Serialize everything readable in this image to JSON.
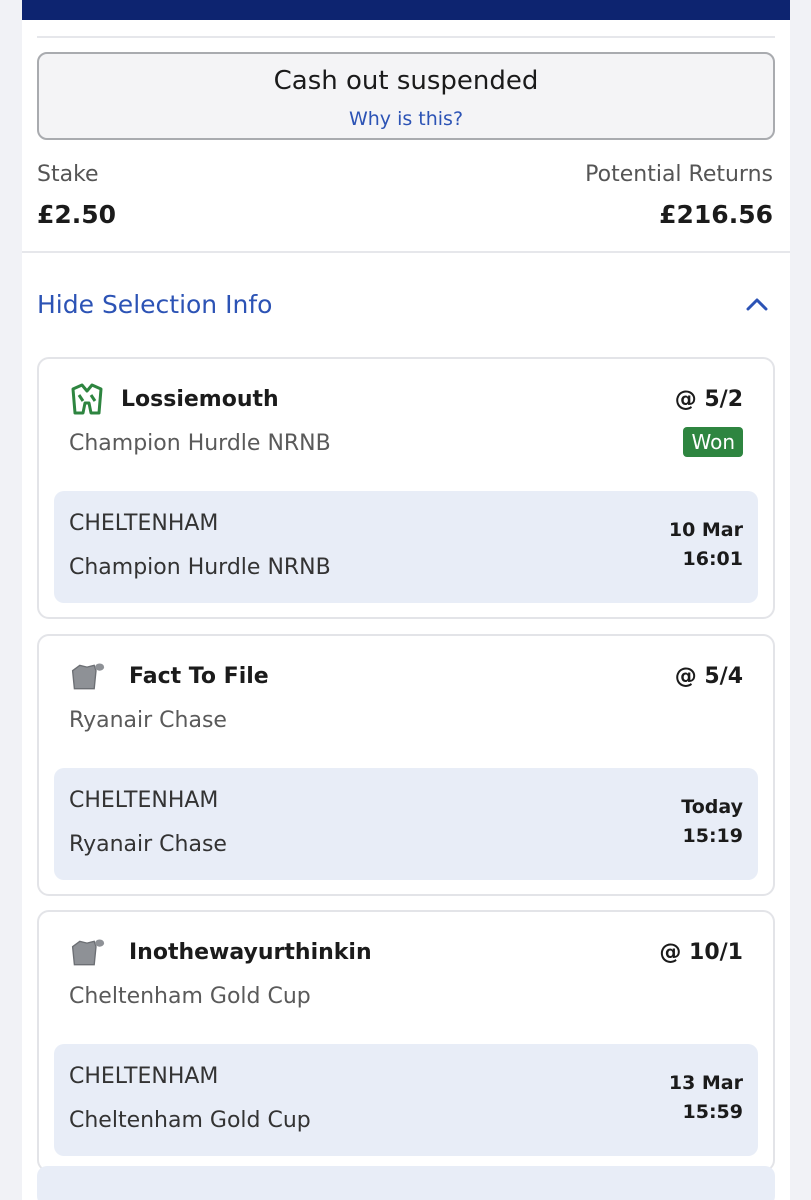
{
  "cashout": {
    "title": "Cash out suspended",
    "link": "Why is this?"
  },
  "bet": {
    "stake_label": "Stake",
    "stake_value": "£2.50",
    "returns_label": "Potential Returns",
    "returns_value": "£216.56"
  },
  "selection_toggle": {
    "label": "Hide Selection Info",
    "icon": "chevron-up-icon"
  },
  "selections": [
    {
      "name": "Lossiemouth",
      "icon": "jockey-silks-green-icon",
      "odds": "@ 5/2",
      "market": "Champion Hurdle NRNB",
      "status": "Won",
      "venue": "CHELTENHAM",
      "race": "Champion Hurdle NRNB",
      "date": "10 Mar",
      "time": "16:01"
    },
    {
      "name": "Fact To File",
      "icon": "jockey-silks-grey-icon",
      "odds": "@ 5/4",
      "market": "Ryanair Chase",
      "status": "",
      "venue": "CHELTENHAM",
      "race": "Ryanair Chase",
      "date": "Today",
      "time": "15:19"
    },
    {
      "name": "Inothewayurthinkin",
      "icon": "jockey-silks-grey-icon",
      "odds": "@ 10/1",
      "market": "Cheltenham Gold Cup",
      "status": "",
      "venue": "CHELTENHAM",
      "race": "Cheltenham Gold Cup",
      "date": "13 Mar",
      "time": "15:59"
    }
  ],
  "colors": {
    "header_navy": "#0d2470",
    "link_blue": "#2c53b5",
    "won_green": "#2e8540",
    "event_bg": "#e8edf7"
  }
}
